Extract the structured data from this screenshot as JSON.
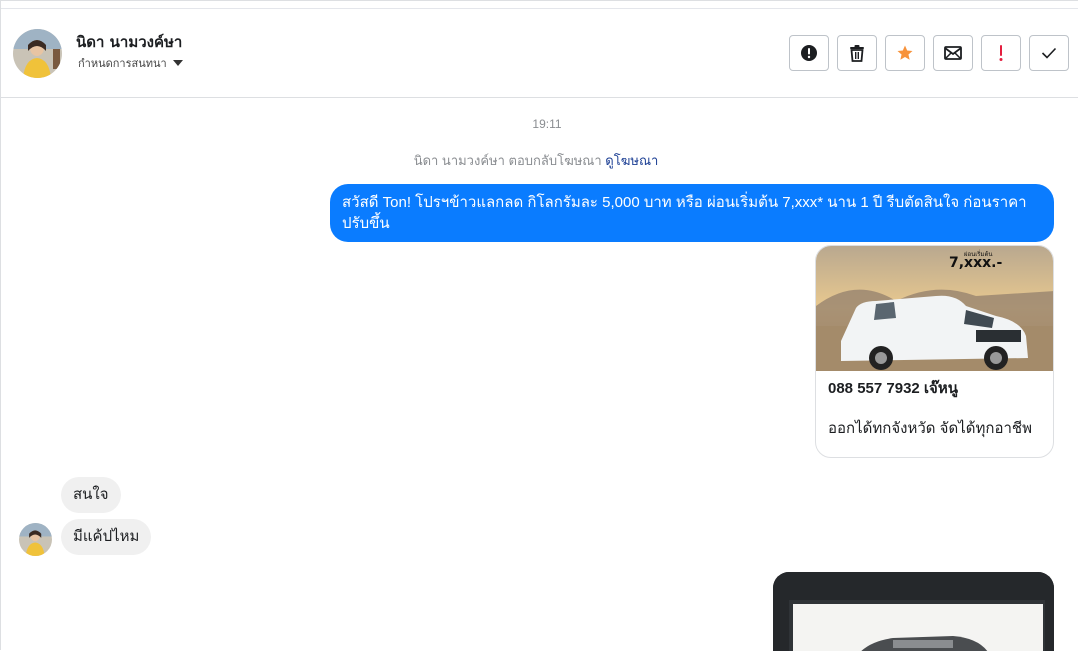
{
  "header": {
    "contact_name": "นิดา นามวงค์ษา",
    "assign_label": "กำหนดการสนทนา",
    "actions": [
      {
        "name": "report-button",
        "icon": "alert-circle-icon"
      },
      {
        "name": "delete-button",
        "icon": "trash-icon"
      },
      {
        "name": "star-button",
        "icon": "star-icon"
      },
      {
        "name": "mark-unread-button",
        "icon": "envelope-icon"
      },
      {
        "name": "important-button",
        "icon": "exclamation-icon"
      },
      {
        "name": "done-button",
        "icon": "check-icon"
      }
    ]
  },
  "thread": {
    "timestamp": "19:11",
    "system_text": "นิดา นามวงค์ษา ตอบกลับโฆษณา",
    "system_link": "ดูโฆษณา",
    "outgoing_message": "สวัสดี Ton! โปรฯข้าวแลกลด กิโลกรัมละ 5,000 บาท หรือ ผ่อนเริ่มต้น 7,xxx* นาน 1 ปี  รีบตัดสินใจ ก่อนราคาปรับขึ้น",
    "ad_card": {
      "image_caption_small": "ผ่อนเริ่มต้น",
      "image_caption_big": "7,xxx.-",
      "title": "088 557 7932 เจ๊หนู",
      "subtitle": "ออกได้ทกจังหวัด จัดได้ทุกอาชีพ"
    },
    "incoming_messages": [
      "สนใจ",
      "มีแค้ปไหม"
    ]
  },
  "colors": {
    "outgoing_bubble": "#0a7cff",
    "incoming_bubble": "#f0f0f0",
    "star": "#f7923a",
    "important": "#e41e3f"
  }
}
